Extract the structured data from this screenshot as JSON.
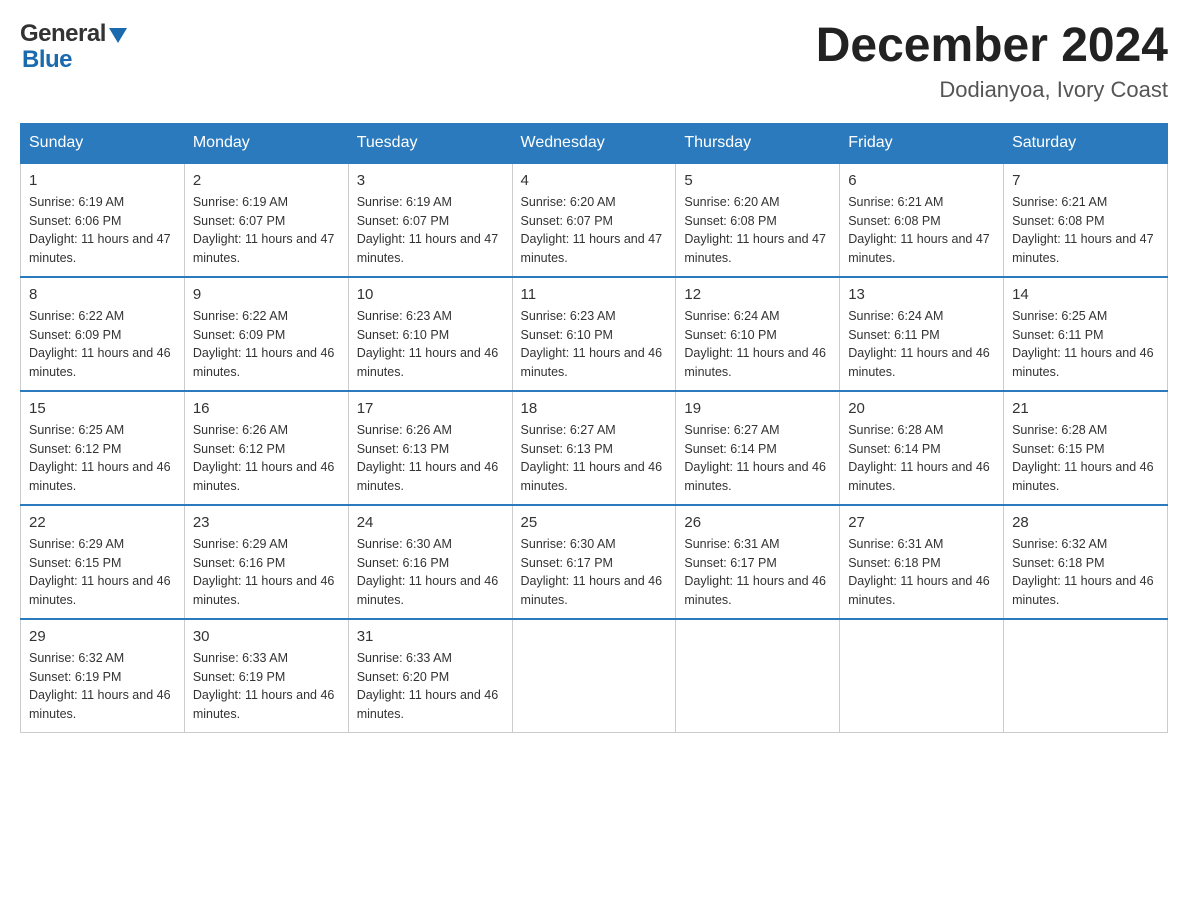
{
  "header": {
    "title": "December 2024",
    "subtitle": "Dodianyoa, Ivory Coast",
    "logo_general": "General",
    "logo_blue": "Blue"
  },
  "days_of_week": [
    "Sunday",
    "Monday",
    "Tuesday",
    "Wednesday",
    "Thursday",
    "Friday",
    "Saturday"
  ],
  "weeks": [
    [
      {
        "day": "1",
        "sunrise": "6:19 AM",
        "sunset": "6:06 PM",
        "daylight": "11 hours and 47 minutes."
      },
      {
        "day": "2",
        "sunrise": "6:19 AM",
        "sunset": "6:07 PM",
        "daylight": "11 hours and 47 minutes."
      },
      {
        "day": "3",
        "sunrise": "6:19 AM",
        "sunset": "6:07 PM",
        "daylight": "11 hours and 47 minutes."
      },
      {
        "day": "4",
        "sunrise": "6:20 AM",
        "sunset": "6:07 PM",
        "daylight": "11 hours and 47 minutes."
      },
      {
        "day": "5",
        "sunrise": "6:20 AM",
        "sunset": "6:08 PM",
        "daylight": "11 hours and 47 minutes."
      },
      {
        "day": "6",
        "sunrise": "6:21 AM",
        "sunset": "6:08 PM",
        "daylight": "11 hours and 47 minutes."
      },
      {
        "day": "7",
        "sunrise": "6:21 AM",
        "sunset": "6:08 PM",
        "daylight": "11 hours and 47 minutes."
      }
    ],
    [
      {
        "day": "8",
        "sunrise": "6:22 AM",
        "sunset": "6:09 PM",
        "daylight": "11 hours and 46 minutes."
      },
      {
        "day": "9",
        "sunrise": "6:22 AM",
        "sunset": "6:09 PM",
        "daylight": "11 hours and 46 minutes."
      },
      {
        "day": "10",
        "sunrise": "6:23 AM",
        "sunset": "6:10 PM",
        "daylight": "11 hours and 46 minutes."
      },
      {
        "day": "11",
        "sunrise": "6:23 AM",
        "sunset": "6:10 PM",
        "daylight": "11 hours and 46 minutes."
      },
      {
        "day": "12",
        "sunrise": "6:24 AM",
        "sunset": "6:10 PM",
        "daylight": "11 hours and 46 minutes."
      },
      {
        "day": "13",
        "sunrise": "6:24 AM",
        "sunset": "6:11 PM",
        "daylight": "11 hours and 46 minutes."
      },
      {
        "day": "14",
        "sunrise": "6:25 AM",
        "sunset": "6:11 PM",
        "daylight": "11 hours and 46 minutes."
      }
    ],
    [
      {
        "day": "15",
        "sunrise": "6:25 AM",
        "sunset": "6:12 PM",
        "daylight": "11 hours and 46 minutes."
      },
      {
        "day": "16",
        "sunrise": "6:26 AM",
        "sunset": "6:12 PM",
        "daylight": "11 hours and 46 minutes."
      },
      {
        "day": "17",
        "sunrise": "6:26 AM",
        "sunset": "6:13 PM",
        "daylight": "11 hours and 46 minutes."
      },
      {
        "day": "18",
        "sunrise": "6:27 AM",
        "sunset": "6:13 PM",
        "daylight": "11 hours and 46 minutes."
      },
      {
        "day": "19",
        "sunrise": "6:27 AM",
        "sunset": "6:14 PM",
        "daylight": "11 hours and 46 minutes."
      },
      {
        "day": "20",
        "sunrise": "6:28 AM",
        "sunset": "6:14 PM",
        "daylight": "11 hours and 46 minutes."
      },
      {
        "day": "21",
        "sunrise": "6:28 AM",
        "sunset": "6:15 PM",
        "daylight": "11 hours and 46 minutes."
      }
    ],
    [
      {
        "day": "22",
        "sunrise": "6:29 AM",
        "sunset": "6:15 PM",
        "daylight": "11 hours and 46 minutes."
      },
      {
        "day": "23",
        "sunrise": "6:29 AM",
        "sunset": "6:16 PM",
        "daylight": "11 hours and 46 minutes."
      },
      {
        "day": "24",
        "sunrise": "6:30 AM",
        "sunset": "6:16 PM",
        "daylight": "11 hours and 46 minutes."
      },
      {
        "day": "25",
        "sunrise": "6:30 AM",
        "sunset": "6:17 PM",
        "daylight": "11 hours and 46 minutes."
      },
      {
        "day": "26",
        "sunrise": "6:31 AM",
        "sunset": "6:17 PM",
        "daylight": "11 hours and 46 minutes."
      },
      {
        "day": "27",
        "sunrise": "6:31 AM",
        "sunset": "6:18 PM",
        "daylight": "11 hours and 46 minutes."
      },
      {
        "day": "28",
        "sunrise": "6:32 AM",
        "sunset": "6:18 PM",
        "daylight": "11 hours and 46 minutes."
      }
    ],
    [
      {
        "day": "29",
        "sunrise": "6:32 AM",
        "sunset": "6:19 PM",
        "daylight": "11 hours and 46 minutes."
      },
      {
        "day": "30",
        "sunrise": "6:33 AM",
        "sunset": "6:19 PM",
        "daylight": "11 hours and 46 minutes."
      },
      {
        "day": "31",
        "sunrise": "6:33 AM",
        "sunset": "6:20 PM",
        "daylight": "11 hours and 46 minutes."
      },
      null,
      null,
      null,
      null
    ]
  ]
}
